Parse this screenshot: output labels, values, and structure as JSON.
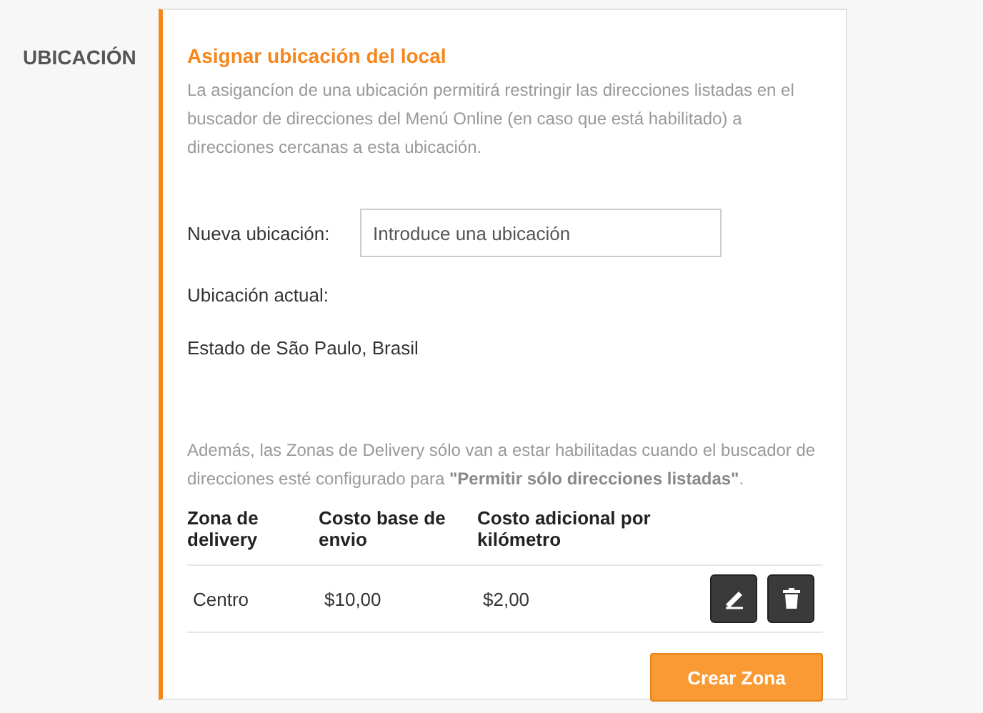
{
  "section_label": "UBICACIÓN",
  "card": {
    "title": "Asignar ubicación del local",
    "description": "La asigancíon de una ubicación permitirá restringir las direcciones listadas en el buscador de direcciones del Menú Online (en caso que está habilitado) a direcciones cercanas a esta ubicación.",
    "new_location": {
      "label": "Nueva ubicación:",
      "placeholder": "Introduce una ubicación"
    },
    "current_location": {
      "label": "Ubicación actual:",
      "value": "Estado de São Paulo, Brasil"
    },
    "note": "Además, las Zonas de Delivery sólo van a estar habilitadas cuando el buscador de direcciones esté configurado para **\"Permitir sólo direcciones listadas\"**.",
    "table": {
      "columns": [
        "Zona de delivery",
        "Costo base de envio",
        "Costo adicional por kilómetro"
      ],
      "rows": [
        {
          "zone": "Centro",
          "base_cost": "$10,00",
          "extra_cost": "$2,00"
        }
      ]
    },
    "create_button": "Crear Zona"
  }
}
